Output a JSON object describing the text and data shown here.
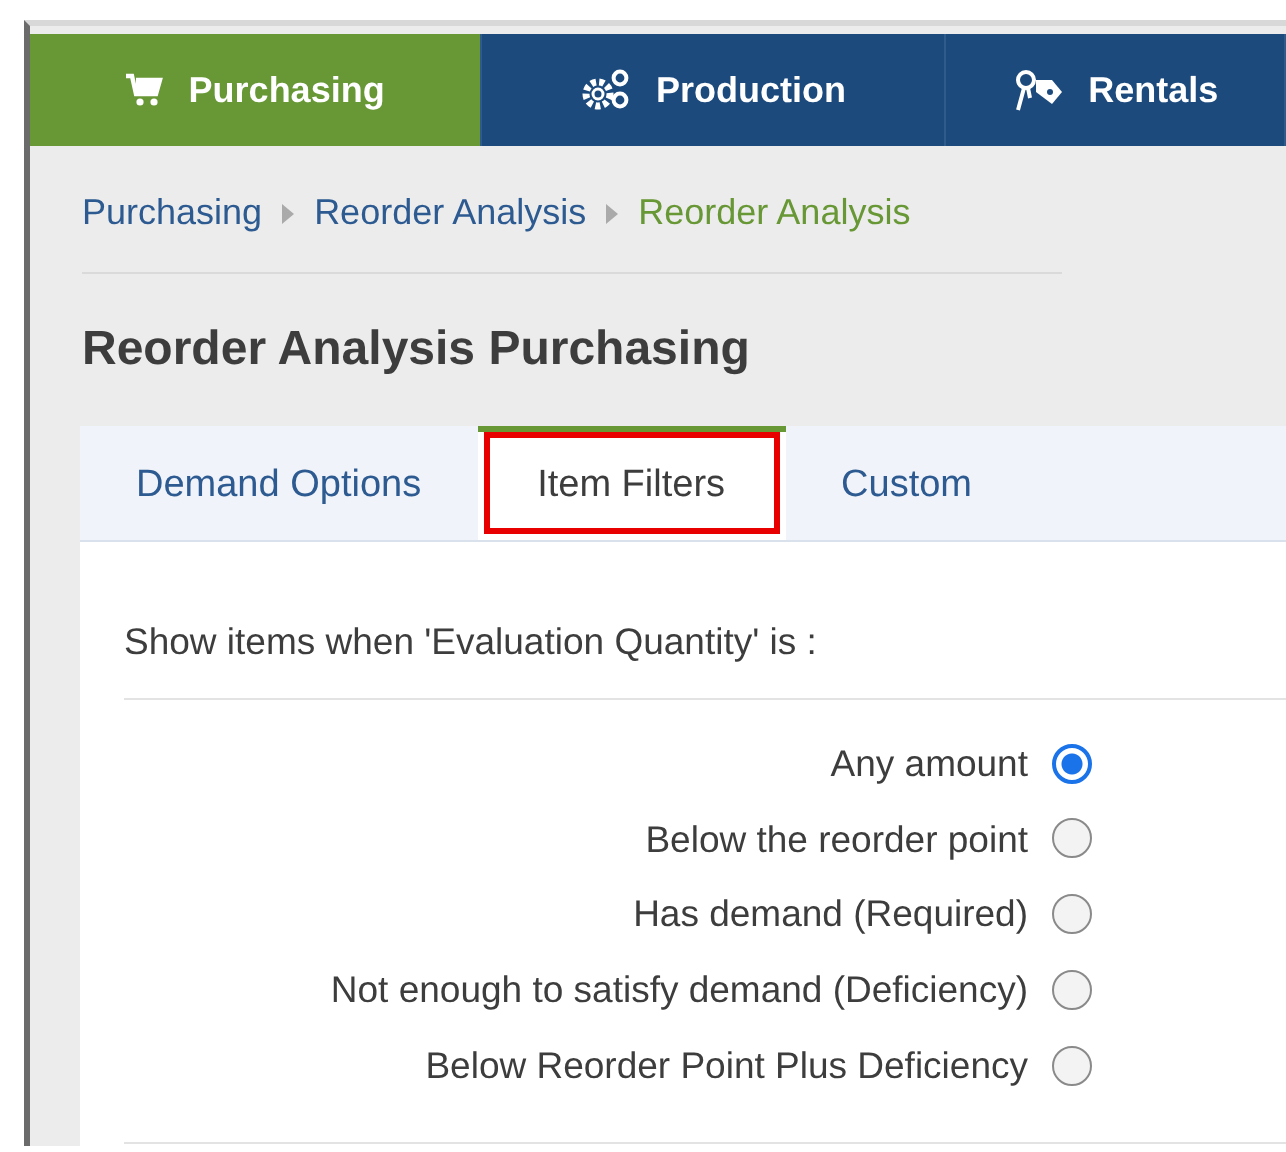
{
  "nav": [
    {
      "label": "Purchasing",
      "selected": true
    },
    {
      "label": "Production",
      "selected": false
    },
    {
      "label": "Rentals",
      "selected": false
    }
  ],
  "breadcrumb": [
    {
      "label": "Purchasing",
      "current": false
    },
    {
      "label": "Reorder Analysis",
      "current": false
    },
    {
      "label": "Reorder Analysis",
      "current": true
    }
  ],
  "title": "Reorder Analysis Purchasing",
  "tabs": [
    {
      "label": "Demand Options",
      "selected": false,
      "highlighted": false
    },
    {
      "label": "Item Filters",
      "selected": true,
      "highlighted": true
    },
    {
      "label": "Custom",
      "selected": false,
      "highlighted": false
    }
  ],
  "filter": {
    "heading": "Show items when 'Evaluation Quantity' is :",
    "options": [
      {
        "label": "Any amount",
        "selected": true
      },
      {
        "label": "Below the reorder point",
        "selected": false
      },
      {
        "label": "Has demand (Required)",
        "selected": false
      },
      {
        "label": "Not enough to satisfy demand (Deficiency)",
        "selected": false
      },
      {
        "label": "Below Reorder Point Plus Deficiency",
        "selected": false
      }
    ]
  }
}
